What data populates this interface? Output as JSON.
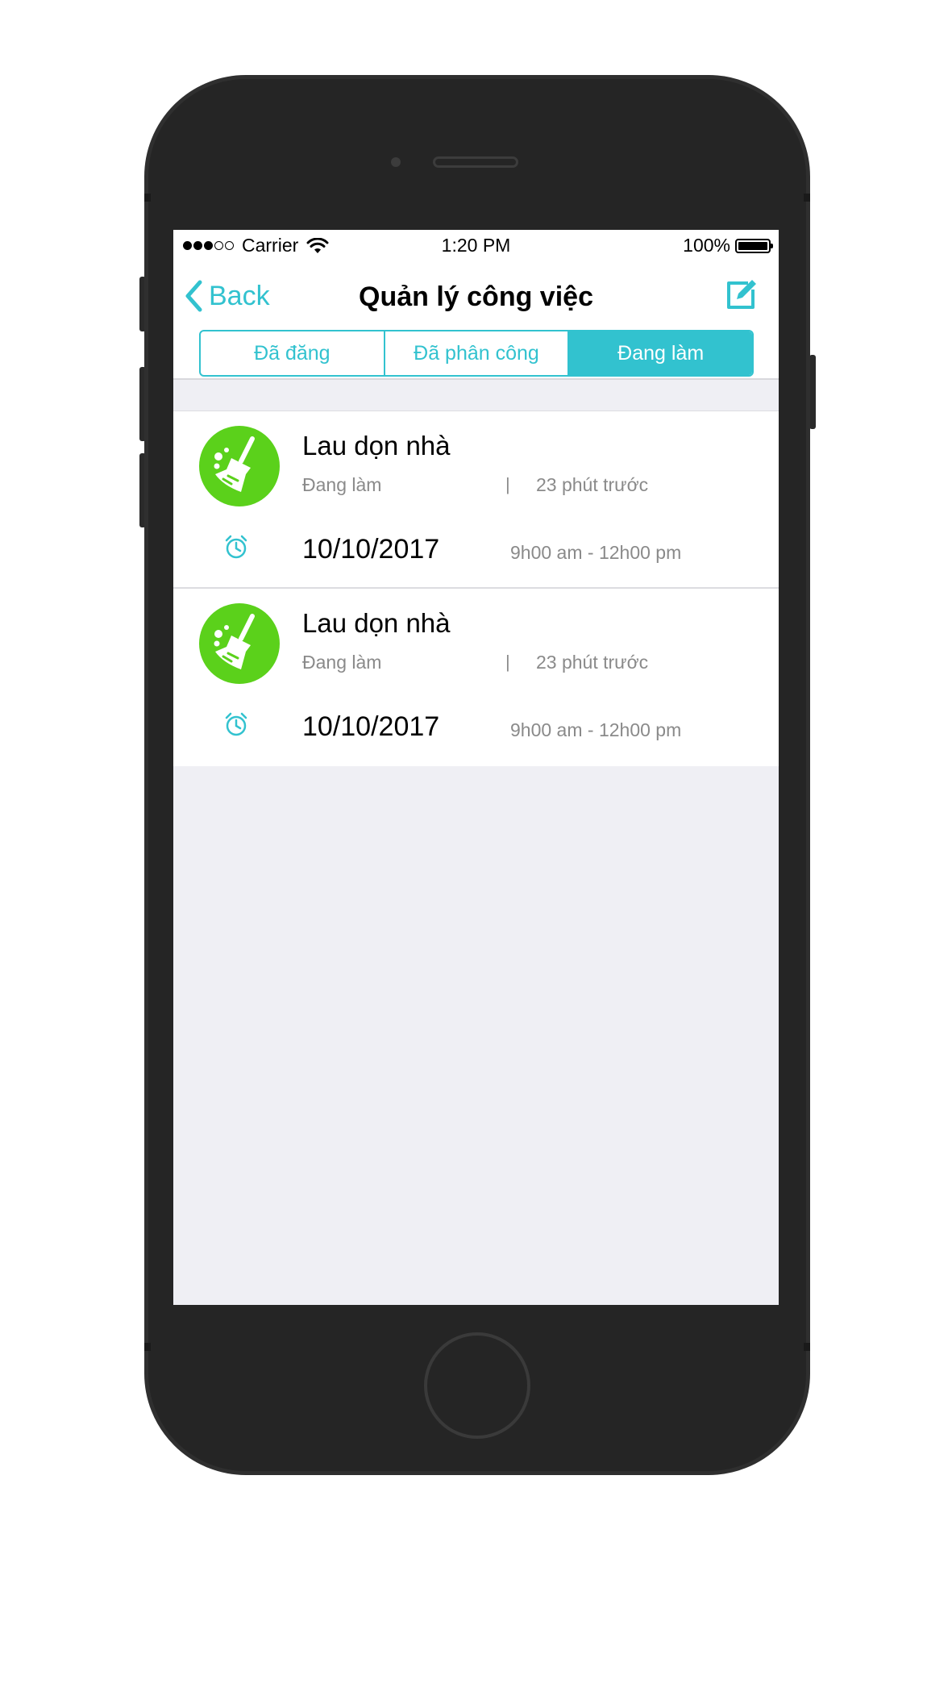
{
  "status_bar": {
    "carrier": "Carrier",
    "time": "1:20 PM",
    "battery": "100%",
    "signal_icon": "signal-dots-icon",
    "wifi_icon": "wifi-icon",
    "battery_icon": "battery-icon"
  },
  "nav": {
    "back_label": "Back",
    "title": "Quản lý công việc",
    "compose_icon": "compose-icon",
    "accent_color": "#32c2cf"
  },
  "tabs": [
    {
      "label": "Đã đăng",
      "active": false
    },
    {
      "label": "Đã phân công",
      "active": false
    },
    {
      "label": "Đang làm",
      "active": true
    }
  ],
  "tasks": [
    {
      "title": "Lau dọn nhà",
      "status": "Đang làm",
      "separator": "|",
      "time_ago": "23 phút trước",
      "date": "10/10/2017",
      "time_range": "9h00 am - 12h00 pm",
      "icon": "broom-icon",
      "icon_color": "#5bd11b"
    },
    {
      "title": "Lau dọn nhà",
      "status": "Đang làm",
      "separator": "|",
      "time_ago": "23 phút trước",
      "date": "10/10/2017",
      "time_range": "9h00 am - 12h00 pm",
      "icon": "broom-icon",
      "icon_color": "#5bd11b"
    }
  ]
}
